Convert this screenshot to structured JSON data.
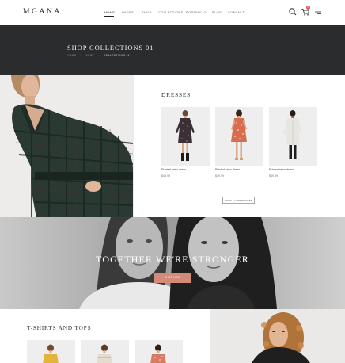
{
  "header": {
    "logo": "MGANA",
    "nav": [
      {
        "label": "HOME",
        "active": true
      },
      {
        "label": "PAGES",
        "active": false
      },
      {
        "label": "SHOP",
        "active": false
      },
      {
        "label": "COLLECTIONS",
        "active": false
      },
      {
        "label": "PORTFOLIO",
        "active": false
      },
      {
        "label": "BLOG",
        "active": false
      },
      {
        "label": "CONTACT",
        "active": false
      }
    ],
    "icons": [
      "search-icon",
      "cart-icon",
      "menu-icon"
    ],
    "cart_count": "0"
  },
  "title_band": {
    "title": "SHOP COLLECTIONS 01",
    "breadcrumb": [
      "HOME",
      "SHOP",
      "COLLECTIONS 01"
    ]
  },
  "dresses": {
    "title": "DRESSES",
    "products": [
      {
        "name": "Printed retro dress",
        "price": "$49.99"
      },
      {
        "name": "Printed retro dress",
        "price": "$49.99"
      },
      {
        "name": "Printed retro dress",
        "price": "$49.99"
      }
    ],
    "view_button": "VIEW ALL PRODUCTS"
  },
  "banner": {
    "headline": "TOGETHER WE'RE STRONGER",
    "button": "SHOP NOW"
  },
  "tshirts": {
    "title": "T-SHIRTS AND TOPS"
  },
  "colors": {
    "accent": "#d38a79",
    "dark_band": "#2b2c2e",
    "badge": "#d9534f"
  }
}
